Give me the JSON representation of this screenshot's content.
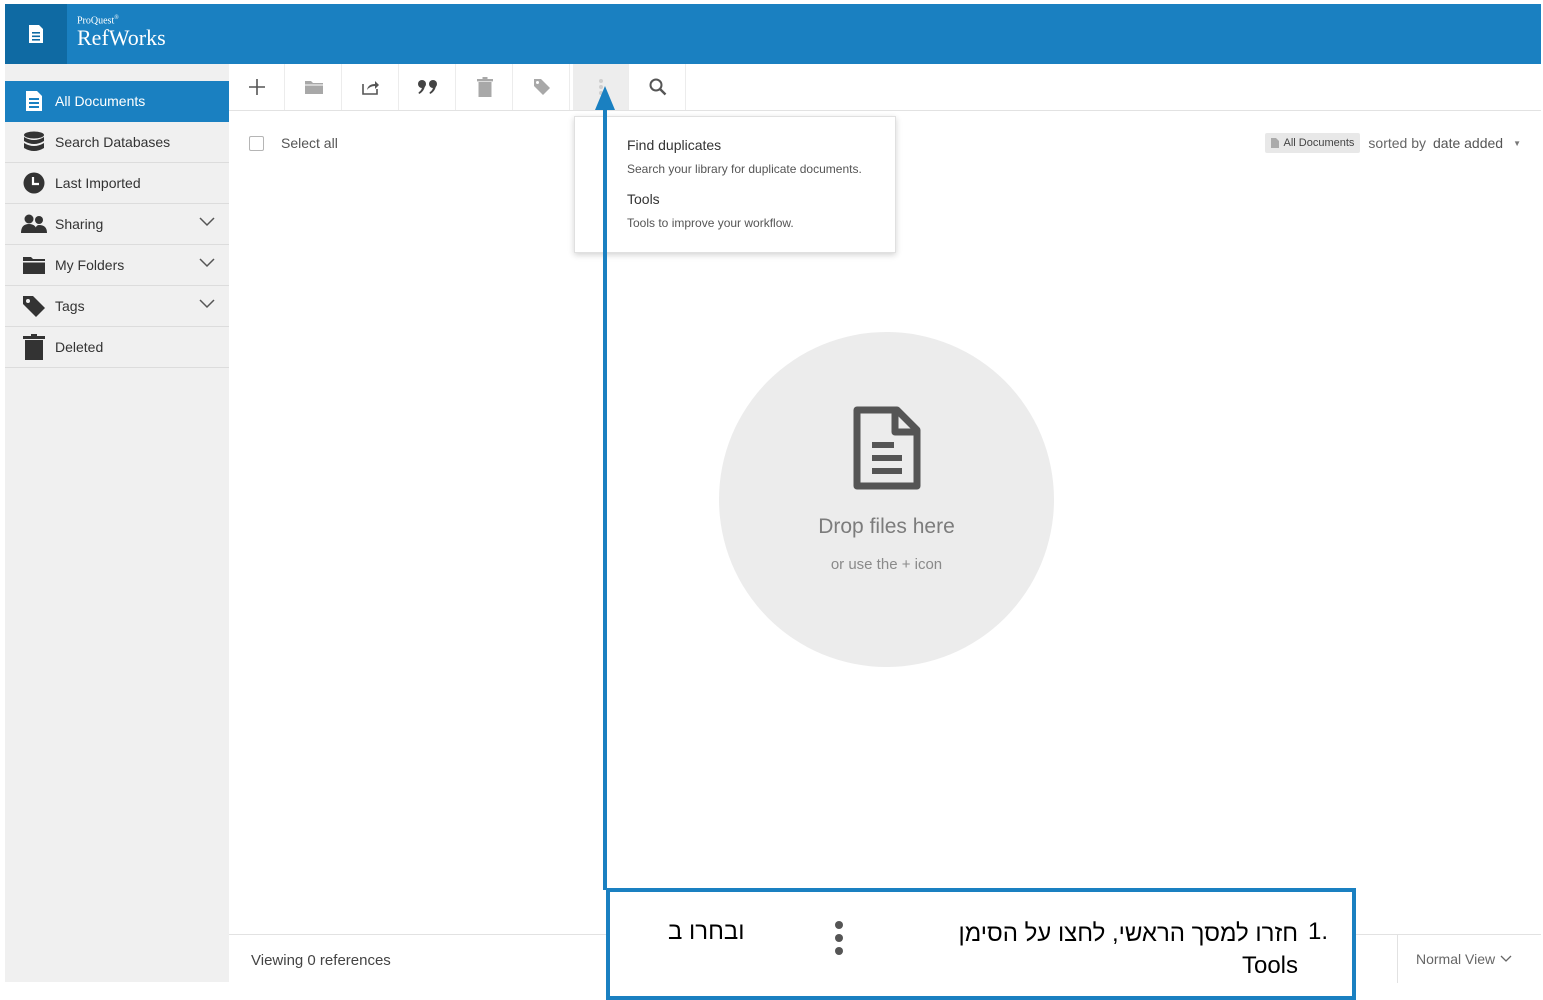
{
  "header": {
    "brand_top": "ProQuest",
    "brand_mark": "®",
    "brand_name": "RefWorks"
  },
  "sidebar": {
    "items": [
      {
        "label": "All Documents",
        "icon": "document-icon",
        "active": true
      },
      {
        "label": "Search Databases",
        "icon": "database-icon"
      },
      {
        "label": "Last Imported",
        "icon": "clock-icon"
      },
      {
        "label": "Sharing",
        "icon": "people-icon",
        "expandable": true
      },
      {
        "label": "My Folders",
        "icon": "folder-icon",
        "expandable": true
      },
      {
        "label": "Tags",
        "icon": "tag-icon",
        "expandable": true
      },
      {
        "label": "Deleted",
        "icon": "trash-icon"
      }
    ]
  },
  "toolbar": {
    "buttons": [
      "add-icon",
      "folder-icon",
      "share-icon",
      "quote-icon",
      "trash-icon",
      "tag-icon",
      "more-vertical-icon",
      "search-icon"
    ],
    "active_button": "more-vertical-icon"
  },
  "list": {
    "select_all_label": "Select all"
  },
  "sort": {
    "badge_label": "All Documents",
    "sorted_by_label": "sorted by",
    "sort_value": "date added"
  },
  "dropdown": {
    "items": [
      {
        "title": "Find duplicates",
        "description": "Search your library for duplicate documents."
      },
      {
        "title": "Tools",
        "description": "Tools to improve your workflow."
      }
    ]
  },
  "dropzone": {
    "title": "Drop files here",
    "subtitle": "or use the + icon"
  },
  "footer": {
    "count_label": "Viewing 0 references",
    "view_label": "Normal View"
  },
  "annotation": {
    "number": "1.",
    "text_line1": "חזרו למסך הראשי, לחצו על הסימן",
    "text_tail": "ובחרו ב",
    "text_line2": "Tools",
    "accent_color": "#1a80c1"
  },
  "colors": {
    "primary": "#1a80c1",
    "primary_dark": "#0f6aa3",
    "sidebar_bg": "#f0f0f0"
  }
}
